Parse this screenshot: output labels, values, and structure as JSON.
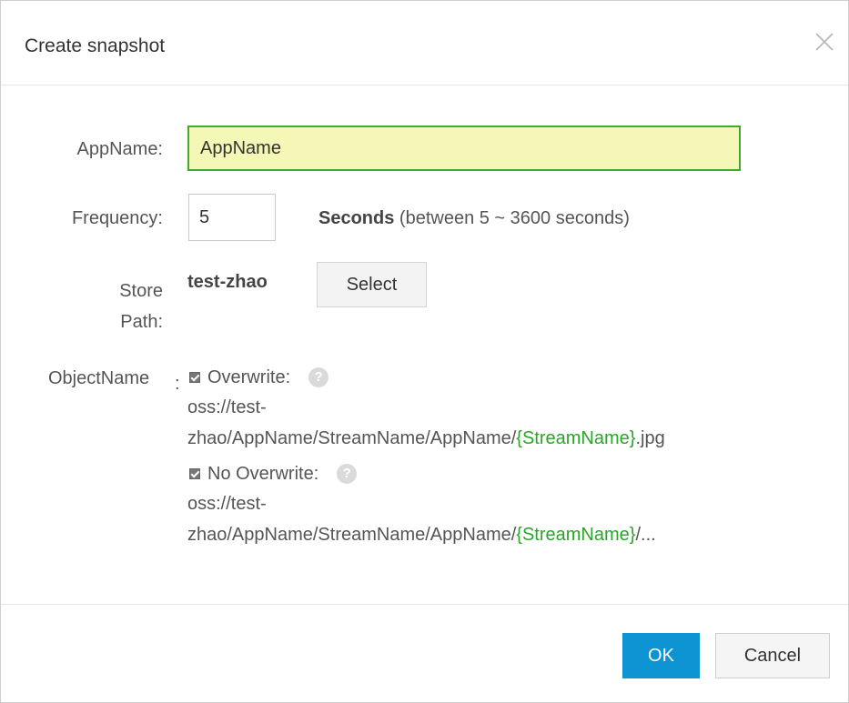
{
  "dialog": {
    "title": "Create snapshot",
    "close_icon": "close-icon"
  },
  "form": {
    "appname": {
      "label": "AppName:",
      "value": "AppName"
    },
    "frequency": {
      "label": "Frequency:",
      "value": "5",
      "unit": "Seconds",
      "hint": " (between 5 ~ 3600 seconds)"
    },
    "store_path": {
      "label_line1": "Store",
      "label_line2": "Path:",
      "value": "test-zhao",
      "select_label": "Select"
    },
    "object_name": {
      "label": "ObjectName",
      "colon": ":",
      "overwrite": {
        "label": "Overwrite:",
        "checked": true,
        "path_line1": "oss://test-",
        "path_prefix": "zhao/AppName/StreamName/AppName/",
        "path_var": "{StreamName}",
        "path_suffix": ".jpg"
      },
      "no_overwrite": {
        "label": "No Overwrite:",
        "checked": true,
        "path_line1": "oss://test-",
        "path_prefix": "zhao/AppName/StreamName/AppName/",
        "path_var": "{StreamName}",
        "path_suffix": "/..."
      },
      "help_icon": "question-icon",
      "help_glyph": "?"
    }
  },
  "footer": {
    "ok_label": "OK",
    "cancel_label": "Cancel"
  },
  "colors": {
    "accent": "#0d93d2",
    "input_highlight_bg": "#f4f7b6",
    "input_highlight_border": "#41a830",
    "variable_green": "#2aa52a"
  }
}
